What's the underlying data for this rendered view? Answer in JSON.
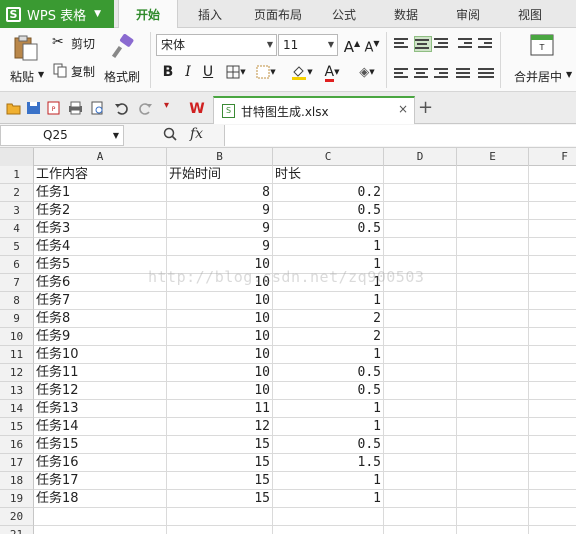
{
  "app": {
    "name": "WPS 表格",
    "logo": "S"
  },
  "menu": {
    "tabs": [
      "开始",
      "插入",
      "页面布局",
      "公式",
      "数据",
      "审阅",
      "视图"
    ],
    "active": "开始"
  },
  "ribbon": {
    "paste_label": "粘贴",
    "cut_label": "剪切",
    "copy_label": "复制",
    "format_painter_label": "格式刷",
    "font_name": "宋体",
    "font_size": "11",
    "grow_font": "A",
    "shrink_font": "A",
    "bold": "B",
    "italic": "I",
    "underline": "U",
    "font_color_glyph": "A",
    "merge_label": "合并居中"
  },
  "doc_tab": {
    "filename": "甘特图生成.xlsx",
    "close": "×",
    "new_tab": "+"
  },
  "formula_bar": {
    "cell_ref": "Q25",
    "fx": "fx",
    "formula": ""
  },
  "grid": {
    "columns": [
      "A",
      "B",
      "C",
      "D",
      "E",
      "F"
    ],
    "rows": [
      {
        "n": "1",
        "a": "工作内容",
        "b": "开始时间",
        "c": "时长"
      },
      {
        "n": "2",
        "a": "任务1",
        "b": "8",
        "c": "0.2"
      },
      {
        "n": "3",
        "a": "任务2",
        "b": "9",
        "c": "0.5"
      },
      {
        "n": "4",
        "a": "任务3",
        "b": "9",
        "c": "0.5"
      },
      {
        "n": "5",
        "a": "任务4",
        "b": "9",
        "c": "1"
      },
      {
        "n": "6",
        "a": "任务5",
        "b": "10",
        "c": "1"
      },
      {
        "n": "7",
        "a": "任务6",
        "b": "10",
        "c": "1"
      },
      {
        "n": "8",
        "a": "任务7",
        "b": "10",
        "c": "1"
      },
      {
        "n": "9",
        "a": "任务8",
        "b": "10",
        "c": "2"
      },
      {
        "n": "10",
        "a": "任务9",
        "b": "10",
        "c": "2"
      },
      {
        "n": "11",
        "a": "任务10",
        "b": "10",
        "c": "1"
      },
      {
        "n": "12",
        "a": "任务11",
        "b": "10",
        "c": "0.5"
      },
      {
        "n": "13",
        "a": "任务12",
        "b": "10",
        "c": "0.5"
      },
      {
        "n": "14",
        "a": "任务13",
        "b": "11",
        "c": "1"
      },
      {
        "n": "15",
        "a": "任务14",
        "b": "12",
        "c": "1"
      },
      {
        "n": "16",
        "a": "任务15",
        "b": "15",
        "c": "0.5"
      },
      {
        "n": "17",
        "a": "任务16",
        "b": "15",
        "c": "1.5"
      },
      {
        "n": "18",
        "a": "任务17",
        "b": "15",
        "c": "1"
      },
      {
        "n": "19",
        "a": "任务18",
        "b": "15",
        "c": "1"
      },
      {
        "n": "20",
        "a": "",
        "b": "",
        "c": ""
      },
      {
        "n": "21",
        "a": "",
        "b": "",
        "c": ""
      }
    ]
  },
  "watermark": "http://blog.csdn.net/zq900503",
  "colors": {
    "brand_green": "#3a9a32",
    "active_tab_text": "#2f8a2a",
    "font_color_red": "#e02020",
    "fill_yellow": "#f5d000"
  }
}
